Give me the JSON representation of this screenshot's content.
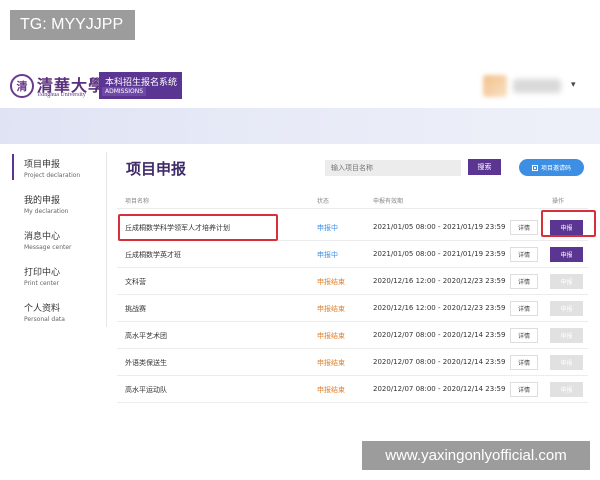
{
  "watermarks": {
    "top": "TG: MYYJJPP",
    "bottom": "www.yaxingonlyofficial.com"
  },
  "header": {
    "logo_seal": "清",
    "logo_cn": "清華大學",
    "logo_en": "Tsinghua University",
    "system_name": "本科招生报名系统",
    "system_sub": "ADMISSIONS",
    "user_caret": "▾"
  },
  "sidebar": {
    "items": [
      {
        "cn": "项目申报",
        "en": "Project declaration",
        "active": true
      },
      {
        "cn": "我的申报",
        "en": "My declaration"
      },
      {
        "cn": "消息中心",
        "en": "Message center"
      },
      {
        "cn": "打印中心",
        "en": "Print center"
      },
      {
        "cn": "个人资料",
        "en": "Personal data"
      }
    ]
  },
  "main": {
    "title": "项目申报",
    "search_placeholder": "输入项目名称",
    "search_button": "搜索",
    "qr_button": "项目邀请码"
  },
  "table": {
    "columns": [
      "项目名称",
      "状态",
      "申报有效期",
      "操作"
    ],
    "rows": [
      {
        "name": "丘成桐数学科学领军人才培养计划",
        "status": "申报中",
        "time": "2021/01/05 08:00 - 2021/01/19 23:59",
        "detail": "详情",
        "apply": "申报",
        "open": true
      },
      {
        "name": "丘成桐数学英才班",
        "status": "申报中",
        "time": "2021/01/05 08:00 - 2021/01/19 23:59",
        "detail": "详情",
        "apply": "申报",
        "open": true
      },
      {
        "name": "文科营",
        "status": "申报结束",
        "time": "2020/12/16 12:00 - 2020/12/23 23:59",
        "detail": "详情",
        "apply": "申报",
        "open": false
      },
      {
        "name": "挑战赛",
        "status": "申报结束",
        "time": "2020/12/16 12:00 - 2020/12/23 23:59",
        "detail": "详情",
        "apply": "申报",
        "open": false
      },
      {
        "name": "高水平艺术团",
        "status": "申报结束",
        "time": "2020/12/07 08:00 - 2020/12/14 23:59",
        "detail": "详情",
        "apply": "申报",
        "open": false
      },
      {
        "name": "外语类保送生",
        "status": "申报结束",
        "time": "2020/12/07 08:00 - 2020/12/14 23:59",
        "detail": "详情",
        "apply": "申报",
        "open": false
      },
      {
        "name": "高水平运动队",
        "status": "申报结束",
        "time": "2020/12/07 08:00 - 2020/12/14 23:59",
        "detail": "详情",
        "apply": "申报",
        "open": false
      }
    ]
  },
  "colors": {
    "brand": "#5b3592",
    "status_open": "#3d8fe4",
    "status_closed": "#e0822d",
    "highlight": "#d6313a"
  }
}
